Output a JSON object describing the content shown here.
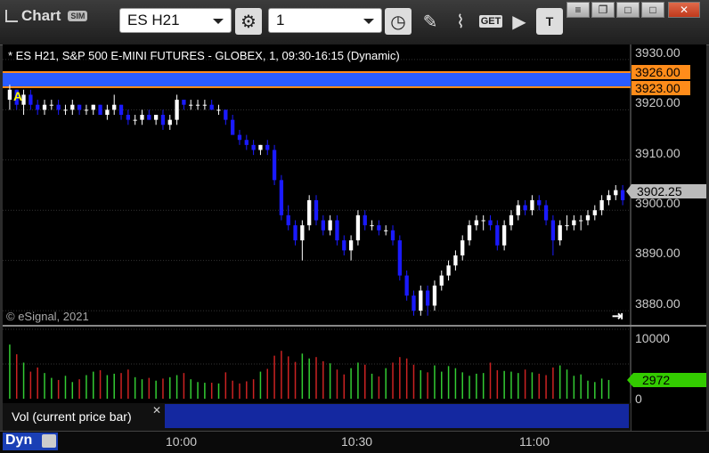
{
  "window": {
    "title": "Chart",
    "sim_badge": "SIM",
    "symbol": "ES H21",
    "interval": "1",
    "controls": [
      "≡",
      "❐",
      "□",
      "✕"
    ]
  },
  "chart": {
    "header": "* ES H21, S&P 500 E-MINI FUTURES - GLOBEX, 1, 09:30-16:15 (Dynamic)",
    "copyright": "© eSignal, 2021",
    "alert_marker": "A",
    "price_ticks": [
      "3930.00",
      "3920.00",
      "3910.00",
      "3900.00",
      "3890.00",
      "3880.00"
    ],
    "price_labels": {
      "upper": "3926.00",
      "lower": "3923.00",
      "last": "3902.25"
    },
    "volume_ticks": [
      "10000",
      "0"
    ],
    "volume_label": "2972",
    "volume_study": "Vol (current price bar)",
    "time_ticks": [
      "10:00",
      "10:30",
      "11:00"
    ],
    "footer": "Dyn",
    "colors": {
      "up": "#ffffff",
      "down": "#1a1aff",
      "vol_up": "#33cc33",
      "vol_down": "#cc2222",
      "band": "#2a5cff",
      "band_line": "#ff8c1a",
      "vol_badge": "#33cc00"
    }
  },
  "chart_data": {
    "type": "candlestick",
    "price_range": [
      3877,
      3933
    ],
    "volume_range": [
      0,
      10000
    ],
    "candles": [
      {
        "o": 3922,
        "h": 3925,
        "l": 3920,
        "c": 3924
      },
      {
        "o": 3924,
        "h": 3924,
        "l": 3920,
        "c": 3921
      },
      {
        "o": 3921,
        "h": 3924,
        "l": 3919,
        "c": 3923
      },
      {
        "o": 3923,
        "h": 3924,
        "l": 3920,
        "c": 3921
      },
      {
        "o": 3921,
        "h": 3922,
        "l": 3919,
        "c": 3920
      },
      {
        "o": 3920,
        "h": 3922,
        "l": 3919,
        "c": 3921
      },
      {
        "o": 3921,
        "h": 3922,
        "l": 3920,
        "c": 3921
      },
      {
        "o": 3921,
        "h": 3922,
        "l": 3919,
        "c": 3920
      },
      {
        "o": 3920,
        "h": 3921,
        "l": 3919,
        "c": 3920
      },
      {
        "o": 3920,
        "h": 3922,
        "l": 3919,
        "c": 3921
      },
      {
        "o": 3921,
        "h": 3921,
        "l": 3919,
        "c": 3920
      },
      {
        "o": 3920,
        "h": 3921,
        "l": 3919,
        "c": 3920
      },
      {
        "o": 3920,
        "h": 3921,
        "l": 3919,
        "c": 3921
      },
      {
        "o": 3921,
        "h": 3921,
        "l": 3919,
        "c": 3919
      },
      {
        "o": 3919,
        "h": 3921,
        "l": 3918,
        "c": 3920
      },
      {
        "o": 3920,
        "h": 3923,
        "l": 3919,
        "c": 3921
      },
      {
        "o": 3921,
        "h": 3921,
        "l": 3918,
        "c": 3919
      },
      {
        "o": 3919,
        "h": 3920,
        "l": 3917,
        "c": 3918
      },
      {
        "o": 3918,
        "h": 3919,
        "l": 3917,
        "c": 3918
      },
      {
        "o": 3918,
        "h": 3920,
        "l": 3917,
        "c": 3919
      },
      {
        "o": 3919,
        "h": 3920,
        "l": 3918,
        "c": 3918
      },
      {
        "o": 3918,
        "h": 3919,
        "l": 3917,
        "c": 3919
      },
      {
        "o": 3919,
        "h": 3920,
        "l": 3916,
        "c": 3917
      },
      {
        "o": 3917,
        "h": 3919,
        "l": 3916,
        "c": 3918
      },
      {
        "o": 3918,
        "h": 3923,
        "l": 3917,
        "c": 3922
      },
      {
        "o": 3922,
        "h": 3922,
        "l": 3920,
        "c": 3921
      },
      {
        "o": 3921,
        "h": 3922,
        "l": 3920,
        "c": 3921
      },
      {
        "o": 3921,
        "h": 3922,
        "l": 3920,
        "c": 3921
      },
      {
        "o": 3921,
        "h": 3922,
        "l": 3920,
        "c": 3921
      },
      {
        "o": 3921,
        "h": 3922,
        "l": 3920,
        "c": 3920
      },
      {
        "o": 3920,
        "h": 3921,
        "l": 3919,
        "c": 3920
      },
      {
        "o": 3920,
        "h": 3920,
        "l": 3917,
        "c": 3918
      },
      {
        "o": 3918,
        "h": 3919,
        "l": 3915,
        "c": 3915
      },
      {
        "o": 3915,
        "h": 3916,
        "l": 3913,
        "c": 3914
      },
      {
        "o": 3914,
        "h": 3915,
        "l": 3912,
        "c": 3913
      },
      {
        "o": 3913,
        "h": 3914,
        "l": 3911,
        "c": 3912
      },
      {
        "o": 3912,
        "h": 3913,
        "l": 3911,
        "c": 3913
      },
      {
        "o": 3913,
        "h": 3914,
        "l": 3911,
        "c": 3912
      },
      {
        "o": 3912,
        "h": 3913,
        "l": 3905,
        "c": 3906
      },
      {
        "o": 3906,
        "h": 3907,
        "l": 3898,
        "c": 3899
      },
      {
        "o": 3899,
        "h": 3901,
        "l": 3896,
        "c": 3897
      },
      {
        "o": 3897,
        "h": 3898,
        "l": 3893,
        "c": 3894
      },
      {
        "o": 3894,
        "h": 3898,
        "l": 3890,
        "c": 3897
      },
      {
        "o": 3897,
        "h": 3903,
        "l": 3896,
        "c": 3902
      },
      {
        "o": 3902,
        "h": 3903,
        "l": 3897,
        "c": 3898
      },
      {
        "o": 3898,
        "h": 3899,
        "l": 3895,
        "c": 3896
      },
      {
        "o": 3896,
        "h": 3899,
        "l": 3895,
        "c": 3898
      },
      {
        "o": 3898,
        "h": 3899,
        "l": 3893,
        "c": 3894
      },
      {
        "o": 3894,
        "h": 3895,
        "l": 3891,
        "c": 3892
      },
      {
        "o": 3892,
        "h": 3895,
        "l": 3890,
        "c": 3894
      },
      {
        "o": 3894,
        "h": 3900,
        "l": 3893,
        "c": 3899
      },
      {
        "o": 3899,
        "h": 3900,
        "l": 3896,
        "c": 3897
      },
      {
        "o": 3897,
        "h": 3898,
        "l": 3896,
        "c": 3897
      },
      {
        "o": 3897,
        "h": 3898,
        "l": 3895,
        "c": 3896
      },
      {
        "o": 3896,
        "h": 3897,
        "l": 3895,
        "c": 3896
      },
      {
        "o": 3896,
        "h": 3897,
        "l": 3893,
        "c": 3894
      },
      {
        "o": 3894,
        "h": 3895,
        "l": 3886,
        "c": 3887
      },
      {
        "o": 3887,
        "h": 3888,
        "l": 3882,
        "c": 3883
      },
      {
        "o": 3883,
        "h": 3884,
        "l": 3879,
        "c": 3880
      },
      {
        "o": 3880,
        "h": 3885,
        "l": 3879,
        "c": 3884
      },
      {
        "o": 3884,
        "h": 3885,
        "l": 3879,
        "c": 3881
      },
      {
        "o": 3881,
        "h": 3886,
        "l": 3880,
        "c": 3885
      },
      {
        "o": 3885,
        "h": 3888,
        "l": 3884,
        "c": 3887
      },
      {
        "o": 3887,
        "h": 3890,
        "l": 3886,
        "c": 3889
      },
      {
        "o": 3889,
        "h": 3892,
        "l": 3888,
        "c": 3891
      },
      {
        "o": 3891,
        "h": 3895,
        "l": 3890,
        "c": 3894
      },
      {
        "o": 3894,
        "h": 3898,
        "l": 3893,
        "c": 3897
      },
      {
        "o": 3897,
        "h": 3899,
        "l": 3896,
        "c": 3898
      },
      {
        "o": 3898,
        "h": 3899,
        "l": 3896,
        "c": 3898
      },
      {
        "o": 3898,
        "h": 3899,
        "l": 3896,
        "c": 3897
      },
      {
        "o": 3897,
        "h": 3898,
        "l": 3892,
        "c": 3893
      },
      {
        "o": 3893,
        "h": 3898,
        "l": 3892,
        "c": 3897
      },
      {
        "o": 3897,
        "h": 3900,
        "l": 3896,
        "c": 3899
      },
      {
        "o": 3899,
        "h": 3902,
        "l": 3898,
        "c": 3901
      },
      {
        "o": 3901,
        "h": 3902,
        "l": 3899,
        "c": 3900
      },
      {
        "o": 3900,
        "h": 3903,
        "l": 3899,
        "c": 3902
      },
      {
        "o": 3902,
        "h": 3903,
        "l": 3900,
        "c": 3901
      },
      {
        "o": 3901,
        "h": 3902,
        "l": 3897,
        "c": 3898
      },
      {
        "o": 3898,
        "h": 3899,
        "l": 3891,
        "c": 3894
      },
      {
        "o": 3894,
        "h": 3898,
        "l": 3893,
        "c": 3897
      },
      {
        "o": 3897,
        "h": 3899,
        "l": 3896,
        "c": 3897
      },
      {
        "o": 3897,
        "h": 3899,
        "l": 3896,
        "c": 3898
      },
      {
        "o": 3898,
        "h": 3899,
        "l": 3896,
        "c": 3898
      },
      {
        "o": 3898,
        "h": 3900,
        "l": 3897,
        "c": 3899
      },
      {
        "o": 3899,
        "h": 3901,
        "l": 3898,
        "c": 3900
      },
      {
        "o": 3900,
        "h": 3903,
        "l": 3899,
        "c": 3902
      },
      {
        "o": 3902,
        "h": 3904,
        "l": 3901,
        "c": 3903
      },
      {
        "o": 3903,
        "h": 3905,
        "l": 3902,
        "c": 3904
      },
      {
        "o": 3904,
        "h": 3905,
        "l": 3901,
        "c": 3902
      }
    ],
    "volumes": [
      7800,
      6400,
      5200,
      3900,
      4500,
      3700,
      3000,
      2700,
      3300,
      2400,
      2800,
      3400,
      3900,
      4100,
      3400,
      3600,
      3700,
      4200,
      3100,
      2800,
      3000,
      2600,
      2900,
      3100,
      3400,
      3700,
      2800,
      2400,
      2300,
      2300,
      2200,
      3800,
      2600,
      2200,
      2500,
      2800,
      3900,
      4300,
      6200,
      6900,
      6100,
      5300,
      6500,
      5800,
      6000,
      5400,
      5100,
      4200,
      3500,
      4400,
      5200,
      4900,
      3600,
      3200,
      4400,
      5200,
      6000,
      5800,
      4900,
      4100,
      3800,
      4800,
      3900,
      4700,
      4400,
      3800,
      3300,
      3600,
      3700,
      5200,
      4100,
      4000,
      3900,
      3700,
      4200,
      3800,
      3600,
      3400,
      4500,
      4800,
      4200,
      3300,
      3500,
      2600,
      2400,
      2900,
      2700
    ]
  }
}
